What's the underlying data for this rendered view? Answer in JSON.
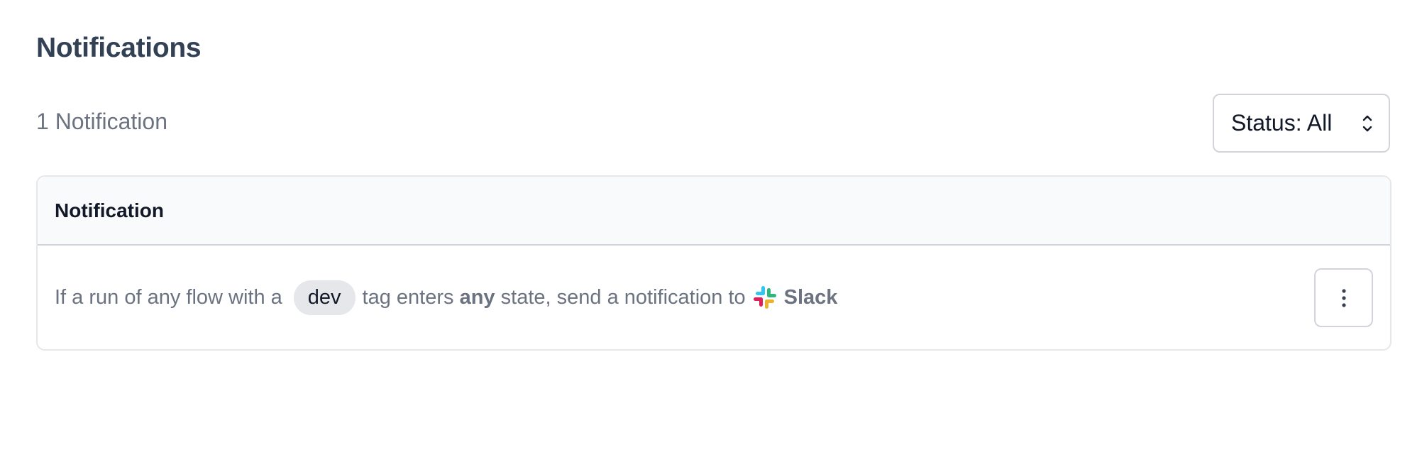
{
  "header": {
    "title": "Notifications"
  },
  "summary": {
    "count_label": "1 Notification"
  },
  "filter": {
    "status_label": "Status: All"
  },
  "table": {
    "column_header": "Notification",
    "rows": [
      {
        "text_before_tag": "If a run of any flow with a",
        "tag": "dev",
        "text_after_tag": "tag enters",
        "state": "any",
        "text_after_state": "state, send a notification to",
        "channel_icon": "slack-logo-icon",
        "channel": "Slack"
      }
    ]
  },
  "icons": {
    "status_chevron": "chevron-up-down-icon",
    "row_menu": "kebab-menu-icon"
  },
  "colors": {
    "slack_blue": "#36C5F0",
    "slack_green": "#2EB67D",
    "slack_red": "#E01E5A",
    "slack_yellow": "#ECB22E"
  }
}
